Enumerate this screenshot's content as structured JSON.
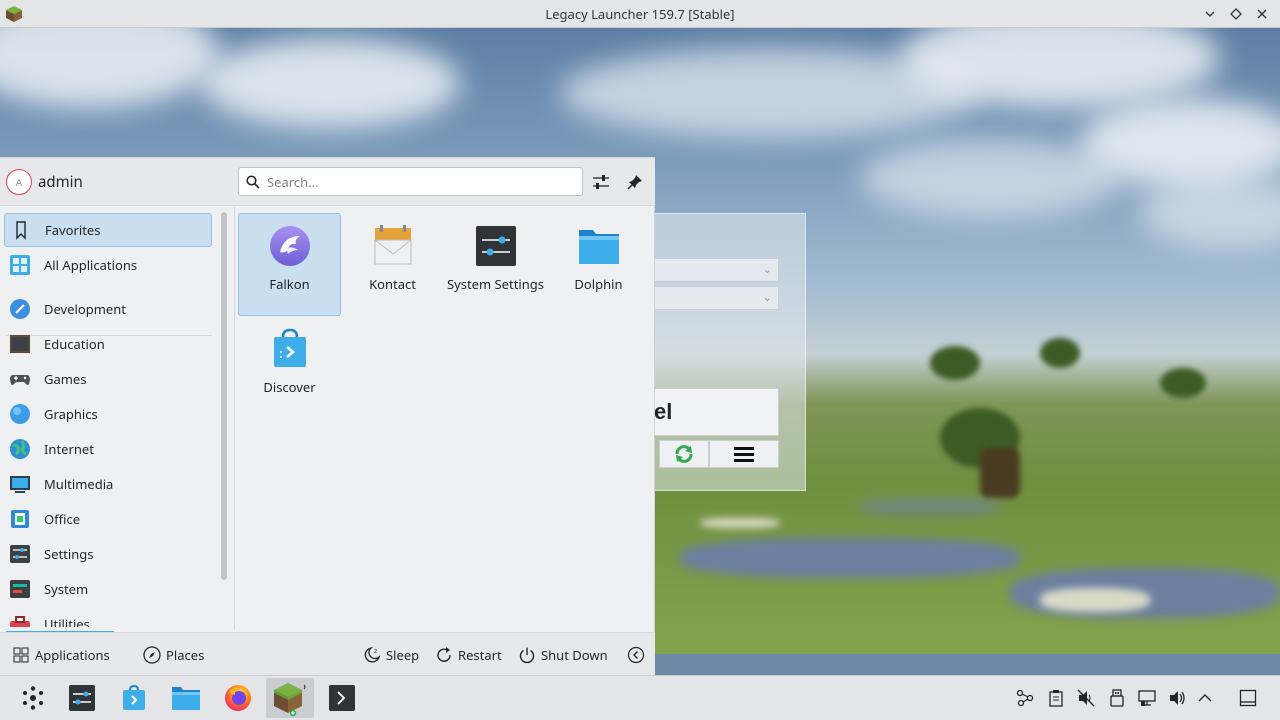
{
  "window": {
    "title": "Legacy Launcher 159.7 [Stable]"
  },
  "launcher_background": {
    "button_text_fragment": "el"
  },
  "menu": {
    "user": {
      "name": "admin",
      "avatar_letter": "A"
    },
    "search": {
      "placeholder": "Search..."
    },
    "sidebar": {
      "items": [
        {
          "label": "Favorites",
          "icon": "bookmark-icon",
          "selected": true
        },
        {
          "label": "All Applications",
          "icon": "grid-icon",
          "selected": false
        },
        {
          "label": "Development",
          "icon": "development-icon",
          "selected": false
        },
        {
          "label": "Education",
          "icon": "education-icon",
          "selected": false
        },
        {
          "label": "Games",
          "icon": "gamepad-icon",
          "selected": false
        },
        {
          "label": "Graphics",
          "icon": "graphics-icon",
          "selected": false
        },
        {
          "label": "Internet",
          "icon": "globe-icon",
          "selected": false
        },
        {
          "label": "Multimedia",
          "icon": "multimedia-icon",
          "selected": false
        },
        {
          "label": "Office",
          "icon": "office-icon",
          "selected": false
        },
        {
          "label": "Settings",
          "icon": "settings-icon",
          "selected": false
        },
        {
          "label": "System",
          "icon": "system-icon",
          "selected": false
        },
        {
          "label": "Utilities",
          "icon": "toolbox-icon",
          "selected": false
        }
      ]
    },
    "favorites": [
      {
        "label": "Falkon",
        "icon": "falkon-icon",
        "selected": true
      },
      {
        "label": "Kontact",
        "icon": "kontact-icon",
        "selected": false
      },
      {
        "label": "System Settings",
        "icon": "system-settings-icon",
        "selected": false
      },
      {
        "label": "Dolphin",
        "icon": "dolphin-folder-icon",
        "selected": false
      },
      {
        "label": "Discover",
        "icon": "discover-icon",
        "selected": false
      }
    ],
    "footer": {
      "applications": "Applications",
      "places": "Places",
      "sleep": "Sleep",
      "restart": "Restart",
      "shutdown": "Shut Down"
    }
  },
  "taskbar": {
    "items": [
      {
        "name": "application-launcher",
        "icon": "kde-launcher-icon"
      },
      {
        "name": "system-settings",
        "icon": "system-settings-icon"
      },
      {
        "name": "discover",
        "icon": "discover-icon"
      },
      {
        "name": "dolphin",
        "icon": "dolphin-folder-icon"
      },
      {
        "name": "firefox",
        "icon": "firefox-icon"
      },
      {
        "name": "legacy-launcher",
        "icon": "minecraft-icon",
        "active": true
      },
      {
        "name": "konsole",
        "icon": "terminal-icon"
      }
    ],
    "tray": [
      "kde-connect-icon",
      "clipboard-icon",
      "audio-muted-icon",
      "usb-icon",
      "network-icon",
      "volume-icon",
      "expand-tray-icon",
      "show-desktop-icon"
    ]
  },
  "colors": {
    "accent": "#3daee9",
    "selection_bg": "#c9dff0",
    "panel_bg": "#eff0f1"
  }
}
